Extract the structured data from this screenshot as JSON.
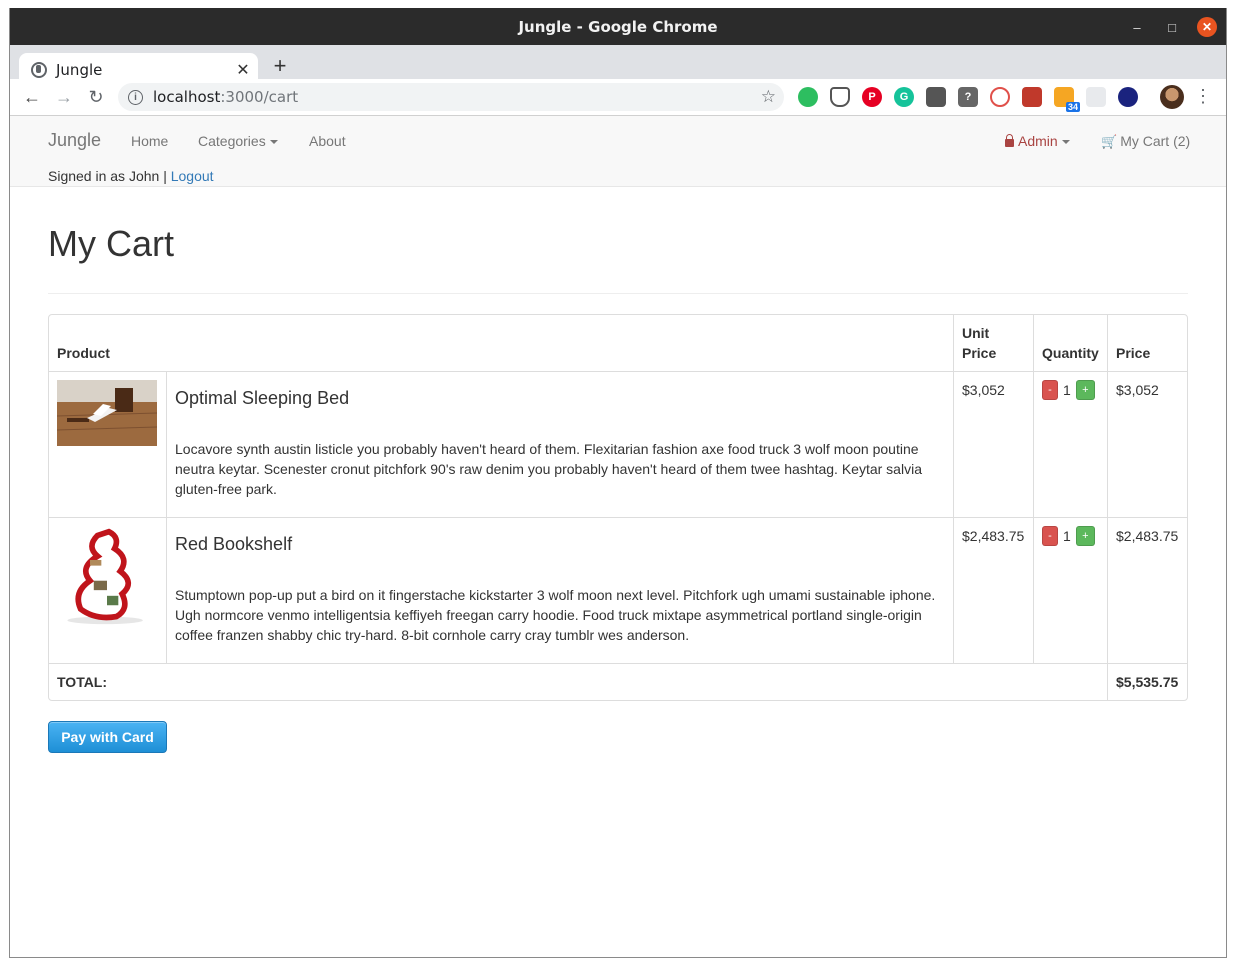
{
  "window": {
    "title": "Jungle - Google Chrome"
  },
  "browser": {
    "tab_title": "Jungle",
    "url_host": "localhost",
    "url_path": ":3000/cart",
    "extensions": [
      "evernote-icon",
      "pocket-icon",
      "pinterest-icon",
      "grammarly-icon",
      "lastpass-icon",
      "help-icon",
      "timer-icon",
      "bookmark-icon",
      "rss-icon",
      "grid-icon",
      "stop-icon"
    ],
    "rss_badge": "34"
  },
  "nav": {
    "brand": "Jungle",
    "home": "Home",
    "categories": "Categories",
    "about": "About",
    "admin": "Admin",
    "cart": "My Cart (2)",
    "signed_in": "Signed in as John | ",
    "logout": "Logout"
  },
  "page": {
    "title": "My Cart"
  },
  "table": {
    "headers": {
      "product": "Product",
      "unit_price": "Unit Price",
      "quantity": "Quantity",
      "price": "Price"
    },
    "items": [
      {
        "name": "Optimal Sleeping Bed",
        "description": "Locavore synth austin listicle you probably haven't heard of them. Flexitarian fashion axe food truck 3 wolf moon poutine neutra keytar. Scenester cronut pitchfork 90's raw denim you probably haven't heard of them twee hashtag. Keytar salvia gluten-free park.",
        "unit_price": "$3,052",
        "quantity": "1",
        "price": "$3,052"
      },
      {
        "name": "Red Bookshelf",
        "description": "Stumptown pop-up put a bird on it fingerstache kickstarter 3 wolf moon next level. Pitchfork ugh umami sustainable iphone. Ugh normcore venmo intelligentsia keffiyeh freegan carry hoodie. Food truck mixtape asymmetrical portland single-origin coffee franzen shabby chic try-hard. 8-bit cornhole carry cray tumblr wes anderson.",
        "unit_price": "$2,483.75",
        "quantity": "1",
        "price": "$2,483.75"
      }
    ],
    "minus_label": "-",
    "plus_label": "+",
    "total_label": "TOTAL:",
    "total_value": "$5,535.75"
  },
  "actions": {
    "pay_label": "Pay with Card"
  },
  "colors": {
    "accent": "#337ab7",
    "danger": "#d9534f",
    "success": "#5cb85c",
    "pay_button": "#1e8fd6",
    "admin": "#a94442"
  }
}
